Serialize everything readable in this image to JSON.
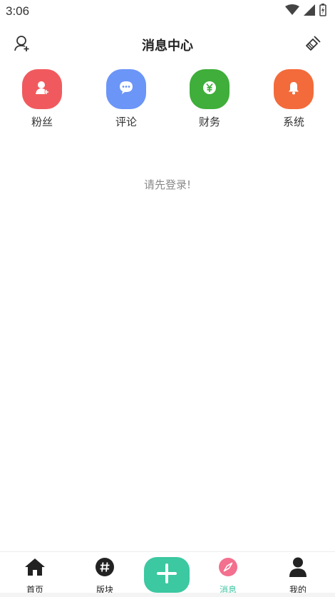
{
  "status_bar": {
    "time": "3:06",
    "icons": [
      "wifi-icon",
      "cell-signal-icon",
      "battery-charging-icon"
    ]
  },
  "header": {
    "title": "消息中心",
    "left_icon": "add-user-icon",
    "right_icon": "broom-icon"
  },
  "categories": [
    {
      "label": "粉丝",
      "icon": "user-plus-icon",
      "color": "#f05a5e"
    },
    {
      "label": "评论",
      "icon": "chat-bubble-icon",
      "color": "#6b95f7"
    },
    {
      "label": "财务",
      "icon": "yen-coin-icon",
      "color": "#3fae3a"
    },
    {
      "label": "系统",
      "icon": "bell-icon",
      "color": "#f36b3b"
    }
  ],
  "empty_message": "请先登录!",
  "tabbar": {
    "accent": "#3cc8a1",
    "active_color": "#f3708f",
    "tabs": [
      {
        "label": "首页",
        "icon": "home-icon"
      },
      {
        "label": "版块",
        "icon": "hashtag-icon"
      },
      {
        "label": "消息",
        "icon": "compass-icon",
        "active": true
      },
      {
        "label": "我的",
        "icon": "person-icon"
      }
    ],
    "center_icon": "plus-icon"
  }
}
